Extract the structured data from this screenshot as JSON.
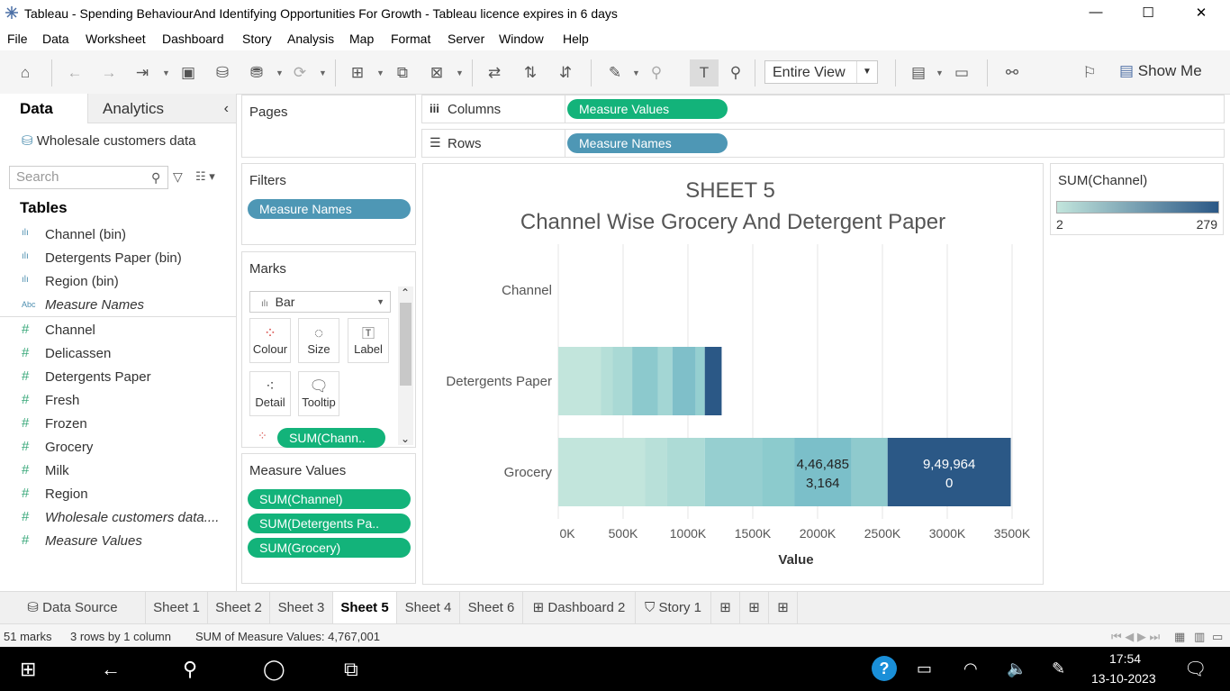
{
  "window": {
    "title": "Tableau - Spending BehaviourAnd Identifying Opportunities For Growth - Tableau licence expires in 6 days",
    "minimize": "—",
    "maximize": "☐",
    "close": "✕"
  },
  "menu": [
    "File",
    "Data",
    "Worksheet",
    "Dashboard",
    "Story",
    "Analysis",
    "Map",
    "Format",
    "Server",
    "Window",
    "Help"
  ],
  "toolbar": {
    "fit_value": "Entire View",
    "show_me_label": "Show Me"
  },
  "data_pane": {
    "tab_data": "Data",
    "tab_analytics": "Analytics",
    "collapse_glyph": "‹",
    "datasource": "Wholesale customers data",
    "search_placeholder": "Search",
    "tables_heading": "Tables",
    "bin_icon": "ılı",
    "abc_icon": "Abc",
    "hash_icon": "#",
    "dimensions": [
      {
        "name": "Channel (bin)",
        "icon": "bin"
      },
      {
        "name": "Detergents Paper (bin)",
        "icon": "bin"
      },
      {
        "name": "Region (bin)",
        "icon": "bin"
      },
      {
        "name": "Measure Names",
        "icon": "abc"
      }
    ],
    "measures": [
      {
        "name": "Channel"
      },
      {
        "name": "Delicassen"
      },
      {
        "name": "Detergents Paper"
      },
      {
        "name": "Fresh"
      },
      {
        "name": "Frozen"
      },
      {
        "name": "Grocery"
      },
      {
        "name": "Milk"
      },
      {
        "name": "Region"
      },
      {
        "name": "Wholesale customers data...."
      },
      {
        "name": "Measure Values"
      }
    ]
  },
  "shelves": {
    "pages_label": "Pages",
    "filters_label": "Filters",
    "filters_pill": "Measure Names",
    "marks_label": "Marks",
    "mark_type": "Bar",
    "mark_buttons": [
      "Colour",
      "Size",
      "Label",
      "Detail",
      "Tooltip"
    ],
    "marks_pill": "SUM(Chann..",
    "measure_values_label": "Measure Values",
    "measure_values_pills": [
      "SUM(Channel)",
      "SUM(Detergents Pa..",
      "SUM(Grocery)"
    ],
    "columns_label": "Columns",
    "columns_pill": "Measure Values",
    "rows_label": "Rows",
    "rows_pill": "Measure Names",
    "columns_glyph": "iii",
    "rows_glyph": "☰"
  },
  "legend": {
    "title": "SUM(Channel)",
    "min_label": "2",
    "max_label": "279",
    "color_low": "#c2e5dc",
    "color_high": "#2b5886"
  },
  "chart_data": {
    "type": "bar",
    "orientation": "horizontal stacked",
    "title": "SHEET 5",
    "subtitle": "Channel Wise Grocery And Detergent Paper",
    "xlabel": "Value",
    "xlim": [
      0,
      3500000
    ],
    "x_ticks": [
      0,
      500000,
      1000000,
      1500000,
      2000000,
      2500000,
      3000000,
      3500000
    ],
    "x_tick_labels": [
      "0K",
      "500K",
      "1000K",
      "1500K",
      "2000K",
      "2500K",
      "3000K",
      "3500K"
    ],
    "grid": "vertical",
    "categories": [
      "Channel",
      "Detergents Paper",
      "Grocery"
    ],
    "segments": {
      "Channel": [],
      "Detergents Paper": [
        {
          "start": 0,
          "end": 330000,
          "color": "#c2e5dc"
        },
        {
          "start": 330000,
          "end": 420000,
          "color": "#b5dfd8"
        },
        {
          "start": 420000,
          "end": 570000,
          "color": "#a9d9d5"
        },
        {
          "start": 570000,
          "end": 770000,
          "color": "#8cc9cd"
        },
        {
          "start": 770000,
          "end": 880000,
          "color": "#a3d6d4"
        },
        {
          "start": 880000,
          "end": 1060000,
          "color": "#7fbfc9"
        },
        {
          "start": 1060000,
          "end": 1130000,
          "color": "#95cfd0"
        },
        {
          "start": 1130000,
          "end": 1260000,
          "color": "#2b5886"
        }
      ],
      "Grocery": [
        {
          "start": 0,
          "end": 670000,
          "color": "#c2e5dc"
        },
        {
          "start": 670000,
          "end": 840000,
          "color": "#b8e0d9"
        },
        {
          "start": 840000,
          "end": 1130000,
          "color": "#addbd6"
        },
        {
          "start": 1130000,
          "end": 1570000,
          "color": "#96cfd0"
        },
        {
          "start": 1570000,
          "end": 1820000,
          "color": "#8ccbcd"
        },
        {
          "start": 1820000,
          "end": 2260000,
          "color": "#7bbfc9",
          "label": [
            "4,46,485",
            "3,164"
          ]
        },
        {
          "start": 2260000,
          "end": 2540000,
          "color": "#8fcacd"
        },
        {
          "start": 2540000,
          "end": 3490000,
          "color": "#2b5886",
          "label": [
            "9,49,964",
            "0"
          ]
        }
      ]
    }
  },
  "sheet_tabs": [
    {
      "label": "Data Source",
      "icon": "⛁"
    },
    {
      "label": "Sheet 1"
    },
    {
      "label": "Sheet 2"
    },
    {
      "label": "Sheet 3"
    },
    {
      "label": "Sheet 5",
      "active": true
    },
    {
      "label": "Sheet 4"
    },
    {
      "label": "Sheet 6"
    },
    {
      "label": "Dashboard 2",
      "icon": "⊞"
    },
    {
      "label": "Story 1",
      "icon": "⛉"
    }
  ],
  "status": {
    "marks": "51 marks",
    "rows": "3 rows  by  1 column",
    "sum": "SUM of Measure Values: 4,767,001"
  },
  "taskbar": {
    "time": "17:54",
    "date": "13-10-2023"
  }
}
